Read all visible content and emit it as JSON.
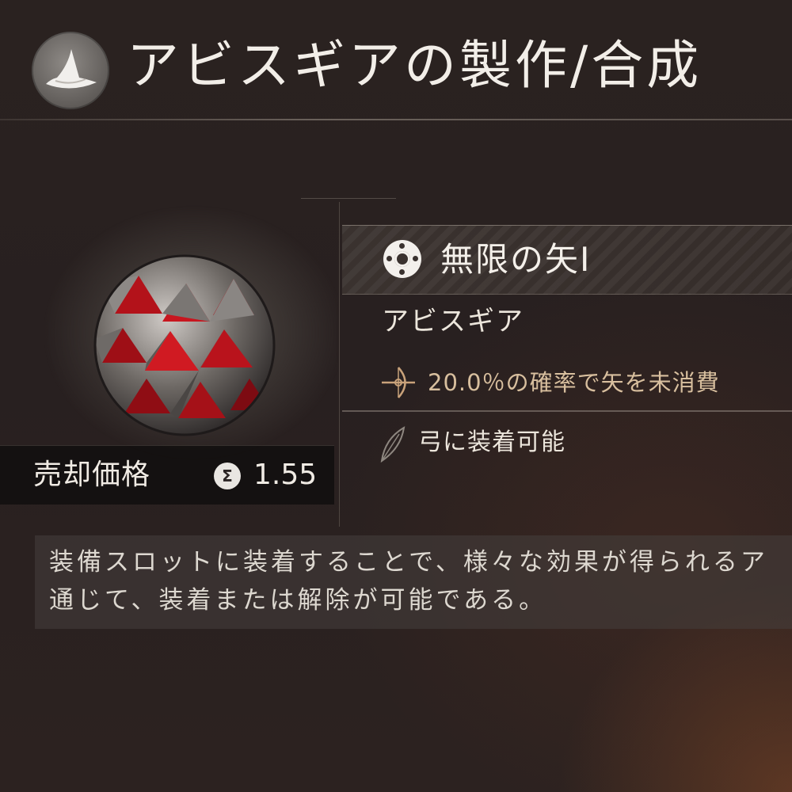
{
  "header": {
    "title": "アビスギアの製作/合成",
    "icon": "wizard-hat-icon"
  },
  "item": {
    "name": "無限の矢I",
    "name_icon": "gear-ring-icon",
    "type": "アビスギア",
    "effect": "20.0％の確率で矢を未消費",
    "effect_icon": "crossbow-icon",
    "equip": "弓に装着可能",
    "equip_icon": "feather-icon",
    "image": "abyss-gear-orb-icon"
  },
  "price": {
    "label": "売却価格",
    "coin_icon": "silver-coin-icon",
    "coin_glyph": "Σ",
    "value": "1.55"
  },
  "description": {
    "lines": [
      "装備スロットに装着することで、様々な効果が得られるア",
      "通じて、装着または解除が可能である。"
    ]
  },
  "colors": {
    "background": "#2a2220",
    "effect_text": "#d8bf9e",
    "orb_red": "#b3121a"
  }
}
